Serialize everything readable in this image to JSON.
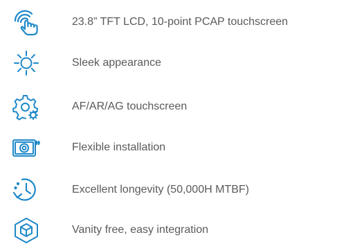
{
  "theme": {
    "icon_color": "#1e88c8",
    "text_color": "#5a5a5a",
    "background": "#ffffff"
  },
  "features": [
    {
      "icon": "touch-gesture-icon",
      "text": "23.8” TFT LCD, 10-point PCAP touchscreen"
    },
    {
      "icon": "sun-brightness-icon",
      "text": "Sleek appearance"
    },
    {
      "icon": "gear-settings-icon",
      "text": "AF/AR/AG touchscreen"
    },
    {
      "icon": "hard-drive-icon",
      "text": "Flexible installation"
    },
    {
      "icon": "clock-refresh-icon",
      "text": "Excellent longevity (50,000H MTBF)"
    },
    {
      "icon": "cube-box-icon",
      "text": "Vanity free, easy integration"
    }
  ]
}
